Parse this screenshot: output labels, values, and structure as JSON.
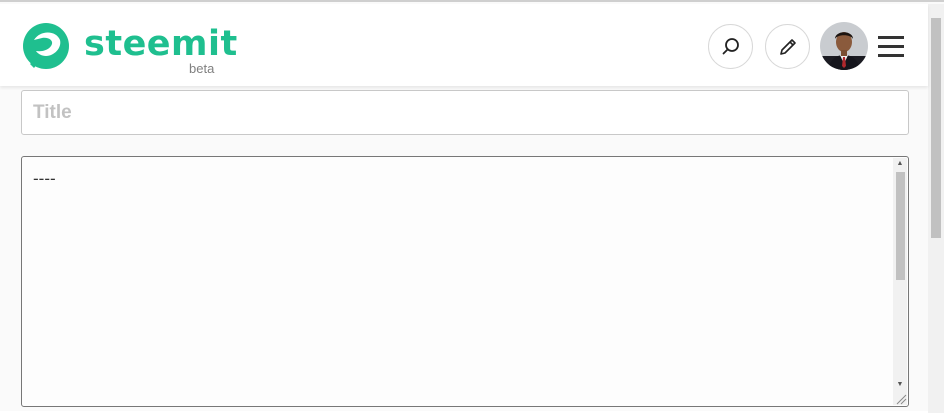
{
  "header": {
    "brand": "steemit",
    "badge": "beta",
    "brand_color": "#1fbf8f",
    "icons": {
      "logo": "steemit-logo",
      "search": "search-icon",
      "edit": "pencil-icon",
      "menu": "hamburger-icon"
    }
  },
  "editor": {
    "title_placeholder": "Title",
    "title_value": "",
    "body_value": "----"
  }
}
